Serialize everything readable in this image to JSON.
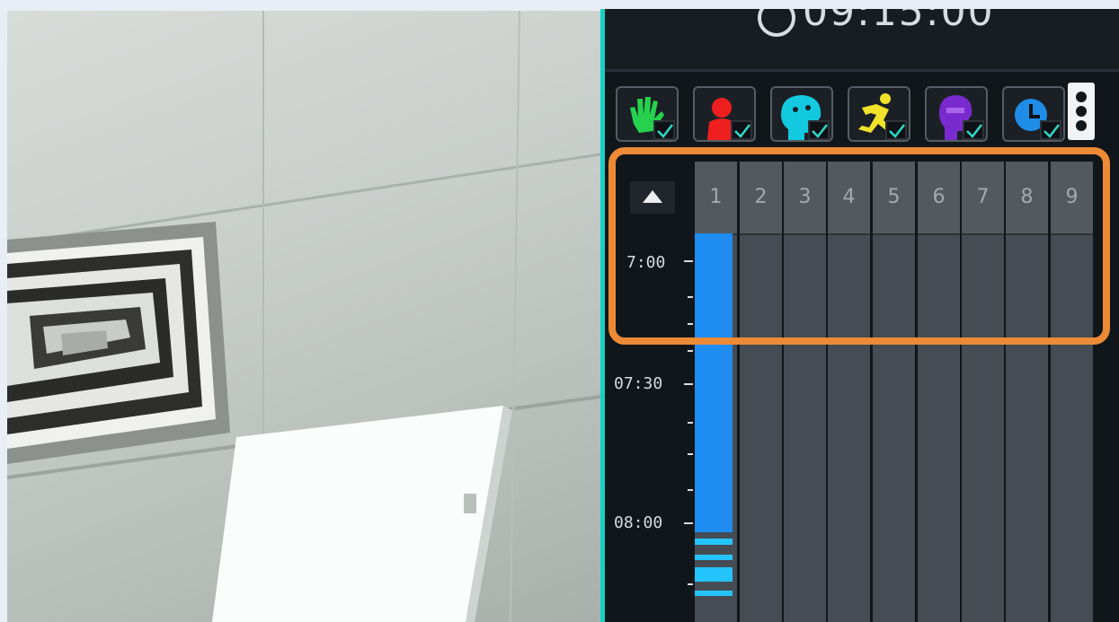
{
  "camera": {
    "name": "live-camera-view"
  },
  "panel": {
    "clock": {
      "time": "09:15:00",
      "icon": "clock-icon"
    },
    "event_icons": [
      {
        "name": "hand-icon",
        "color": "#26d14d",
        "checked": true
      },
      {
        "name": "person-icon",
        "color": "#ef1f1f",
        "checked": true
      },
      {
        "name": "face-icon",
        "color": "#12c9df",
        "checked": true
      },
      {
        "name": "running-man-icon",
        "color": "#f0e32a",
        "checked": true
      },
      {
        "name": "face-recognition-icon",
        "color": "#7a2bcf",
        "checked": true
      },
      {
        "name": "schedule-icon",
        "color": "#1f8ce8",
        "checked": true
      }
    ],
    "more_icon": "more-vertical-icon",
    "timeline": {
      "scroll_up_icon": "triangle-up-icon",
      "channels": [
        "1",
        "2",
        "3",
        "4",
        "5",
        "6",
        "7",
        "8",
        "9"
      ],
      "time_labels": [
        "7:00",
        "07:30",
        "08:00"
      ],
      "recording_color": "#1e8cf0"
    }
  },
  "highlight_color": "#ec8a36"
}
